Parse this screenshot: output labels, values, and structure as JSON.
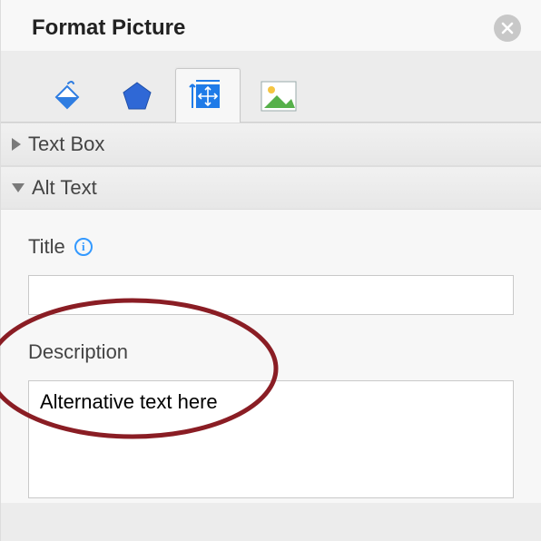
{
  "header": {
    "title": "Format Picture"
  },
  "tabs": {
    "items": [
      {
        "name": "fill-line-tab"
      },
      {
        "name": "effects-tab"
      },
      {
        "name": "size-properties-tab"
      },
      {
        "name": "picture-tab"
      }
    ],
    "active_index": 2
  },
  "sections": {
    "textbox": {
      "label": "Text Box",
      "expanded": false
    },
    "alttext": {
      "label": "Alt Text",
      "expanded": true
    }
  },
  "alttext": {
    "title_label": "Title",
    "title_value": "",
    "description_label": "Description",
    "description_value": "Alternative text here"
  }
}
